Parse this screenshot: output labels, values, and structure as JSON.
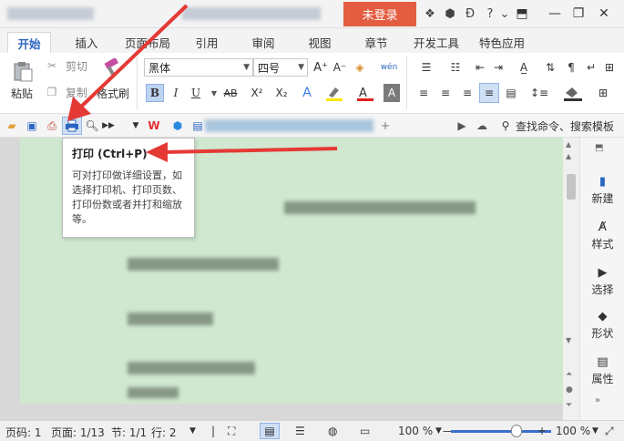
{
  "titlebar": {
    "login_label": "未登录",
    "minimize": "—",
    "restore": "❐",
    "close": "✕"
  },
  "tabs": [
    {
      "label": "开始",
      "active": true
    },
    {
      "label": "插入"
    },
    {
      "label": "页面布局"
    },
    {
      "label": "引用"
    },
    {
      "label": "审阅"
    },
    {
      "label": "视图"
    },
    {
      "label": "章节"
    },
    {
      "label": "开发工具"
    },
    {
      "label": "特色应用"
    }
  ],
  "ribbon": {
    "paste": "粘贴",
    "cut": "剪切",
    "copy": "复制",
    "format_painter": "格式刷",
    "font_name": "黑体",
    "font_size": "四号",
    "bold": "B",
    "italic": "I",
    "underline": "U",
    "strike": "AB",
    "superscript": "X²",
    "subscript": "X₂"
  },
  "qab": {
    "search_label": "查找命令、搜索模板"
  },
  "tooltip": {
    "title": "打印 (Ctrl+P)",
    "desc": "可对打印做详细设置，如选择打印机、打印页数、打印份数或者并打和缩放等。"
  },
  "task_pane": [
    {
      "label": "新建",
      "icon": "plus-doc-icon"
    },
    {
      "label": "样式",
      "icon": "style-icon"
    },
    {
      "label": "选择",
      "icon": "select-icon"
    },
    {
      "label": "形状",
      "icon": "shape-icon"
    },
    {
      "label": "属性",
      "icon": "property-icon"
    }
  ],
  "status": {
    "page_no": "页码: 1",
    "pages": "页面: 1/13",
    "section": "节: 1/1",
    "row": "行: 2",
    "zoom_left": "100 %",
    "zoom_right": "100 %"
  },
  "colors": {
    "accent": "#2b66c2",
    "login_bg": "#e35d41",
    "page_bg": "#cfe8cf",
    "arrow": "#e53935"
  }
}
